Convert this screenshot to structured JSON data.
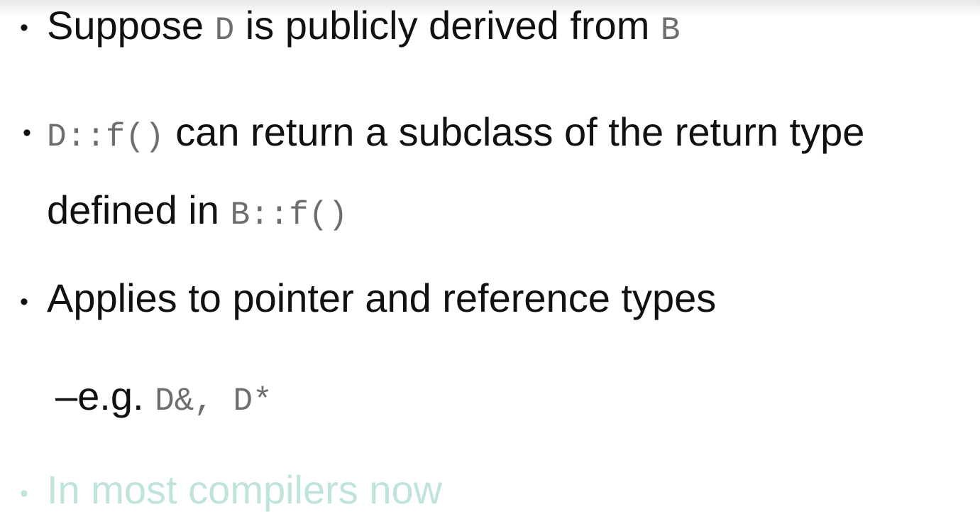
{
  "bullet_char": "•",
  "colors": {
    "text": "#111111",
    "code": "#6e6e6e",
    "faded": "#bfe3dd"
  },
  "slide": {
    "line1": {
      "text_a": "Suppose ",
      "code_a": "D",
      "text_b": " is publicly derived from ",
      "code_b": "B"
    },
    "line2": {
      "code_a": "D::f()",
      "text_a": "  can return  a subclass of the return type"
    },
    "line3": {
      "text_a": "defined in ",
      "code_a": "B::f()"
    },
    "line4": {
      "text_a": "Applies to pointer and reference types"
    },
    "line5": {
      "dash": "–",
      "text_a": "e.g. ",
      "code_a": "D&, D*"
    },
    "line6": {
      "text_a": "In most compilers now"
    }
  }
}
